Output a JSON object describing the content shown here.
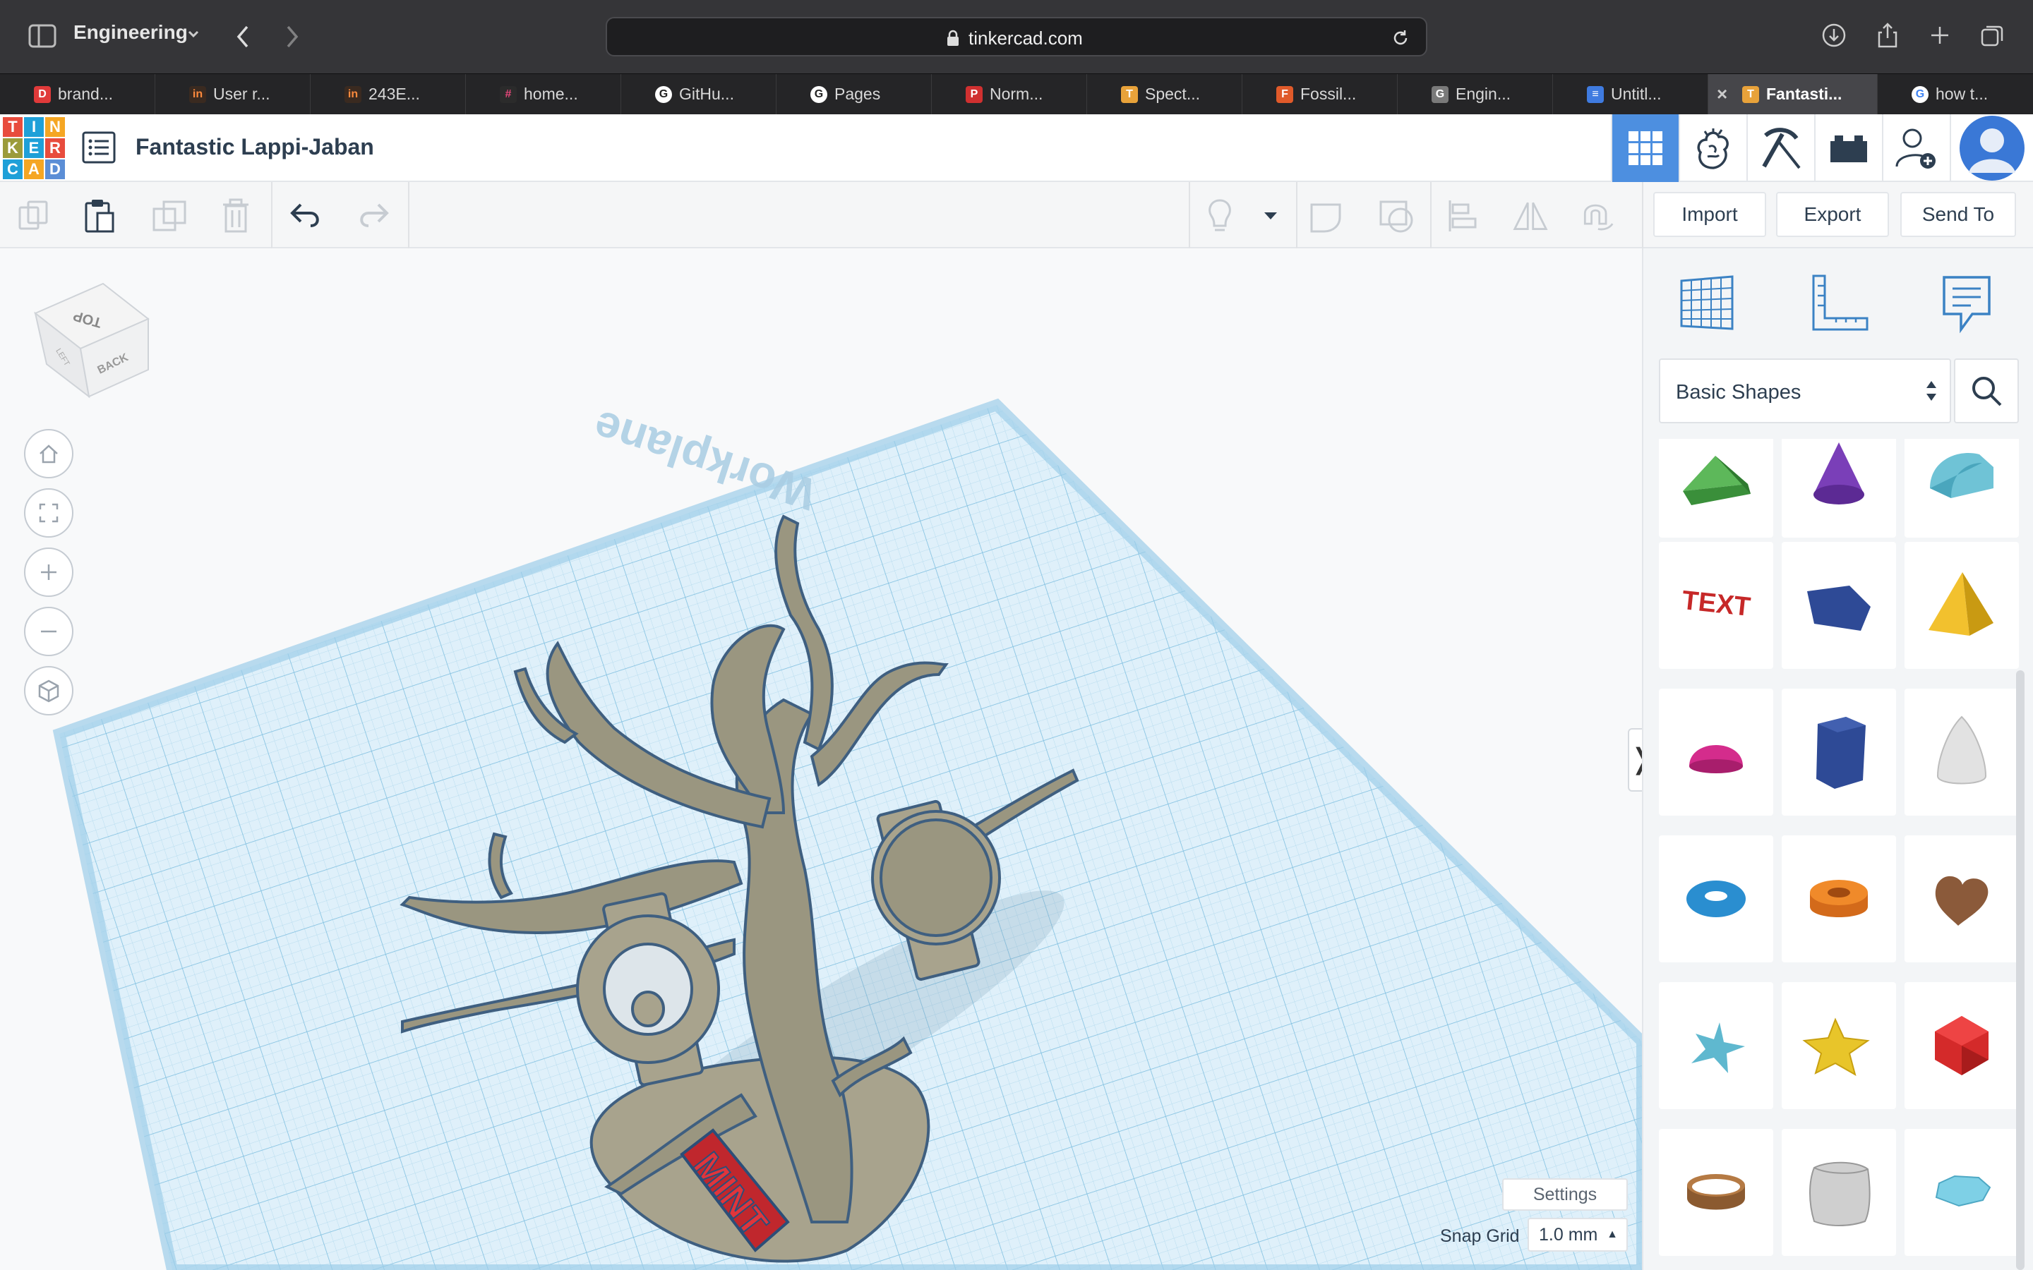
{
  "browser": {
    "profile": "Engineering",
    "url": "tinkercad.com",
    "tabs": [
      {
        "label": "brand...",
        "favicon_letter": "D",
        "favicon_color": "#e03a3a"
      },
      {
        "label": "User r...",
        "favicon_letter": "in",
        "favicon_color": "#ff8a3d"
      },
      {
        "label": "243E...",
        "favicon_letter": "in",
        "favicon_color": "#ff8a3d"
      },
      {
        "label": "home...",
        "favicon_letter": "#",
        "favicon_color": "#e6477a"
      },
      {
        "label": "GitHu...",
        "favicon_letter": "G",
        "favicon_color": "#ffffff"
      },
      {
        "label": "Pages",
        "favicon_letter": "G",
        "favicon_color": "#ffffff"
      },
      {
        "label": "Norm...",
        "favicon_letter": "P",
        "favicon_color": "#d03030"
      },
      {
        "label": "Spect...",
        "favicon_letter": "T",
        "favicon_color": "#e8a23a"
      },
      {
        "label": "Fossil...",
        "favicon_letter": "F",
        "favicon_color": "#e05a2a"
      },
      {
        "label": "Engin...",
        "favicon_letter": "G",
        "favicon_color": "#7a7a7a"
      },
      {
        "label": "Untitl...",
        "favicon_letter": "≡",
        "favicon_color": "#3f7be0"
      },
      {
        "label": "Fantasti...",
        "favicon_letter": "T",
        "favicon_color": "#e8a23a"
      },
      {
        "label": "how t...",
        "favicon_letter": "G",
        "favicon_color": "#ffffff"
      }
    ]
  },
  "app": {
    "logo_letters": [
      "T",
      "I",
      "N",
      "K",
      "E",
      "R",
      "C",
      "A",
      "D"
    ],
    "logo_colors": [
      "#e84c3d",
      "#1fa0d8",
      "#f5a623",
      "#9b9b3a",
      "#1fa0d8",
      "#e84c3d",
      "#1fa0d8",
      "#f5a623",
      "#5b8ed6"
    ],
    "project_title": "Fantastic Lappi-Jaban",
    "accent_color": "#4d8fe0"
  },
  "toolbar": {
    "import_label": "Import",
    "export_label": "Export",
    "send_to_label": "Send To"
  },
  "workplane": {
    "cube_top_label": "TOP",
    "cube_front_label": "BACK",
    "cube_side_label": "LEFT",
    "plane_label": "Workplane",
    "text_object": "MINT",
    "settings_label": "Settings",
    "snap_grid_label": "Snap Grid",
    "snap_grid_value": "1.0 mm"
  },
  "library": {
    "selected": "Basic Shapes",
    "shapes": [
      "wedge",
      "cone",
      "half-cylinder",
      "text",
      "polygon",
      "pyramid",
      "half-sphere",
      "hexagonal-prism",
      "paraboloid",
      "torus",
      "tube",
      "heart",
      "star",
      "star-gold",
      "icosahedron",
      "ring",
      "rounded-box",
      "gem"
    ]
  }
}
